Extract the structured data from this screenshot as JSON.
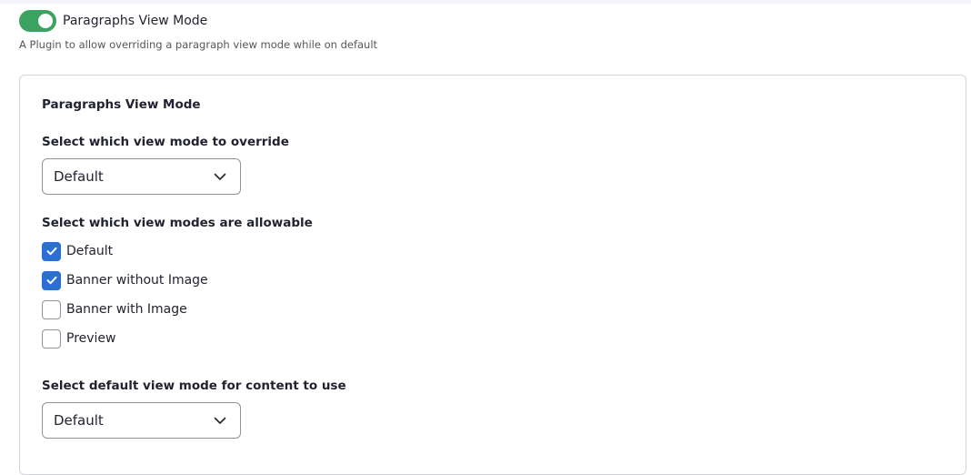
{
  "plugin": {
    "title": "Paragraphs View Mode",
    "description": "A Plugin to allow overriding a paragraph view mode while on default",
    "enabled": true,
    "toggle_color": "#3aa361"
  },
  "card": {
    "title": "Paragraphs View Mode",
    "override": {
      "label": "Select which view mode to override",
      "selected": "Default"
    },
    "allowable": {
      "label": "Select which view modes are allowable",
      "options": [
        {
          "label": "Default",
          "checked": true
        },
        {
          "label": "Banner without Image",
          "checked": true
        },
        {
          "label": "Banner with Image",
          "checked": false
        },
        {
          "label": "Preview",
          "checked": false
        }
      ]
    },
    "default_mode": {
      "label": "Select default view mode for content to use",
      "selected": "Default"
    }
  },
  "colors": {
    "checkbox_accent": "#2a6fd6",
    "border": "#8e929c"
  }
}
